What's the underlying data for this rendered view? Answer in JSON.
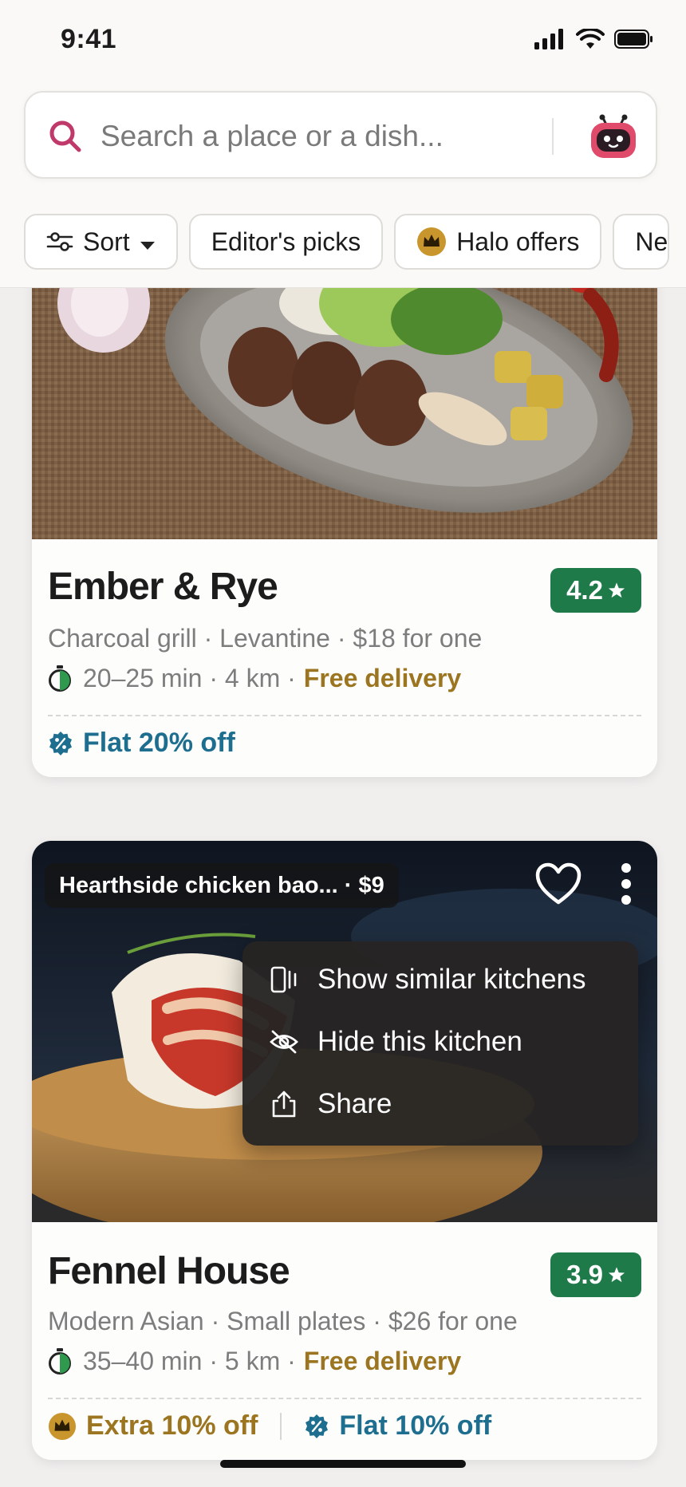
{
  "status_bar": {
    "time": "9:41"
  },
  "search": {
    "placeholder": "Search a place or a dish..."
  },
  "chips": [
    {
      "label": "Sort",
      "icon": "sliders-icon",
      "has_dropdown": true
    },
    {
      "label": "Editor's picks"
    },
    {
      "label": "Halo offers",
      "icon": "crown-badge-icon"
    },
    {
      "label": "Ne"
    }
  ],
  "restaurants": [
    {
      "name": "Ember & Rye",
      "rating": "4.2",
      "meta": "Charcoal grill · Levantine · $18 for one",
      "eta": "20–25 min · 4 km ·",
      "delivery": "Free delivery",
      "offers": [
        {
          "label": "Flat 20% off",
          "icon": "discount-badge-icon"
        }
      ]
    },
    {
      "name": "Fennel House",
      "rating": "3.9",
      "dish_highlight": "Hearthside chicken bao... · $9",
      "meta": "Modern Asian · Small plates · $26 for one",
      "eta": "35–40 min · 5 km ·",
      "delivery": "Free delivery",
      "offers": [
        {
          "label": "Extra 10% off",
          "icon": "crown-badge-icon"
        },
        {
          "label": "Flat 10% off",
          "icon": "discount-badge-icon"
        }
      ]
    }
  ],
  "context_menu": {
    "items": [
      {
        "label": "Show similar kitchens",
        "icon": "similar-icon"
      },
      {
        "label": "Hide this kitchen",
        "icon": "eye-off-icon"
      },
      {
        "label": "Share",
        "icon": "share-icon"
      }
    ]
  },
  "colors": {
    "rating_green": "#1f7a4a",
    "offer_blue": "#1d6e8f",
    "gold": "#9b7520",
    "search_accent": "#c0396b"
  }
}
